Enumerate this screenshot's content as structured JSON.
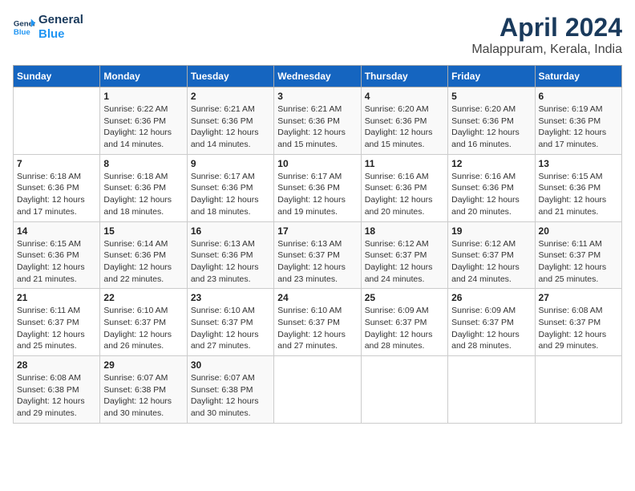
{
  "logo": {
    "line1": "General",
    "line2": "Blue"
  },
  "title": "April 2024",
  "subtitle": "Malappuram, Kerala, India",
  "headers": [
    "Sunday",
    "Monday",
    "Tuesday",
    "Wednesday",
    "Thursday",
    "Friday",
    "Saturday"
  ],
  "weeks": [
    [
      {
        "day": "",
        "info": ""
      },
      {
        "day": "1",
        "info": "Sunrise: 6:22 AM\nSunset: 6:36 PM\nDaylight: 12 hours\nand 14 minutes."
      },
      {
        "day": "2",
        "info": "Sunrise: 6:21 AM\nSunset: 6:36 PM\nDaylight: 12 hours\nand 14 minutes."
      },
      {
        "day": "3",
        "info": "Sunrise: 6:21 AM\nSunset: 6:36 PM\nDaylight: 12 hours\nand 15 minutes."
      },
      {
        "day": "4",
        "info": "Sunrise: 6:20 AM\nSunset: 6:36 PM\nDaylight: 12 hours\nand 15 minutes."
      },
      {
        "day": "5",
        "info": "Sunrise: 6:20 AM\nSunset: 6:36 PM\nDaylight: 12 hours\nand 16 minutes."
      },
      {
        "day": "6",
        "info": "Sunrise: 6:19 AM\nSunset: 6:36 PM\nDaylight: 12 hours\nand 17 minutes."
      }
    ],
    [
      {
        "day": "7",
        "info": "Sunrise: 6:18 AM\nSunset: 6:36 PM\nDaylight: 12 hours\nand 17 minutes."
      },
      {
        "day": "8",
        "info": "Sunrise: 6:18 AM\nSunset: 6:36 PM\nDaylight: 12 hours\nand 18 minutes."
      },
      {
        "day": "9",
        "info": "Sunrise: 6:17 AM\nSunset: 6:36 PM\nDaylight: 12 hours\nand 18 minutes."
      },
      {
        "day": "10",
        "info": "Sunrise: 6:17 AM\nSunset: 6:36 PM\nDaylight: 12 hours\nand 19 minutes."
      },
      {
        "day": "11",
        "info": "Sunrise: 6:16 AM\nSunset: 6:36 PM\nDaylight: 12 hours\nand 20 minutes."
      },
      {
        "day": "12",
        "info": "Sunrise: 6:16 AM\nSunset: 6:36 PM\nDaylight: 12 hours\nand 20 minutes."
      },
      {
        "day": "13",
        "info": "Sunrise: 6:15 AM\nSunset: 6:36 PM\nDaylight: 12 hours\nand 21 minutes."
      }
    ],
    [
      {
        "day": "14",
        "info": "Sunrise: 6:15 AM\nSunset: 6:36 PM\nDaylight: 12 hours\nand 21 minutes."
      },
      {
        "day": "15",
        "info": "Sunrise: 6:14 AM\nSunset: 6:36 PM\nDaylight: 12 hours\nand 22 minutes."
      },
      {
        "day": "16",
        "info": "Sunrise: 6:13 AM\nSunset: 6:36 PM\nDaylight: 12 hours\nand 23 minutes."
      },
      {
        "day": "17",
        "info": "Sunrise: 6:13 AM\nSunset: 6:37 PM\nDaylight: 12 hours\nand 23 minutes."
      },
      {
        "day": "18",
        "info": "Sunrise: 6:12 AM\nSunset: 6:37 PM\nDaylight: 12 hours\nand 24 minutes."
      },
      {
        "day": "19",
        "info": "Sunrise: 6:12 AM\nSunset: 6:37 PM\nDaylight: 12 hours\nand 24 minutes."
      },
      {
        "day": "20",
        "info": "Sunrise: 6:11 AM\nSunset: 6:37 PM\nDaylight: 12 hours\nand 25 minutes."
      }
    ],
    [
      {
        "day": "21",
        "info": "Sunrise: 6:11 AM\nSunset: 6:37 PM\nDaylight: 12 hours\nand 25 minutes."
      },
      {
        "day": "22",
        "info": "Sunrise: 6:10 AM\nSunset: 6:37 PM\nDaylight: 12 hours\nand 26 minutes."
      },
      {
        "day": "23",
        "info": "Sunrise: 6:10 AM\nSunset: 6:37 PM\nDaylight: 12 hours\nand 27 minutes."
      },
      {
        "day": "24",
        "info": "Sunrise: 6:10 AM\nSunset: 6:37 PM\nDaylight: 12 hours\nand 27 minutes."
      },
      {
        "day": "25",
        "info": "Sunrise: 6:09 AM\nSunset: 6:37 PM\nDaylight: 12 hours\nand 28 minutes."
      },
      {
        "day": "26",
        "info": "Sunrise: 6:09 AM\nSunset: 6:37 PM\nDaylight: 12 hours\nand 28 minutes."
      },
      {
        "day": "27",
        "info": "Sunrise: 6:08 AM\nSunset: 6:37 PM\nDaylight: 12 hours\nand 29 minutes."
      }
    ],
    [
      {
        "day": "28",
        "info": "Sunrise: 6:08 AM\nSunset: 6:38 PM\nDaylight: 12 hours\nand 29 minutes."
      },
      {
        "day": "29",
        "info": "Sunrise: 6:07 AM\nSunset: 6:38 PM\nDaylight: 12 hours\nand 30 minutes."
      },
      {
        "day": "30",
        "info": "Sunrise: 6:07 AM\nSunset: 6:38 PM\nDaylight: 12 hours\nand 30 minutes."
      },
      {
        "day": "",
        "info": ""
      },
      {
        "day": "",
        "info": ""
      },
      {
        "day": "",
        "info": ""
      },
      {
        "day": "",
        "info": ""
      }
    ]
  ]
}
